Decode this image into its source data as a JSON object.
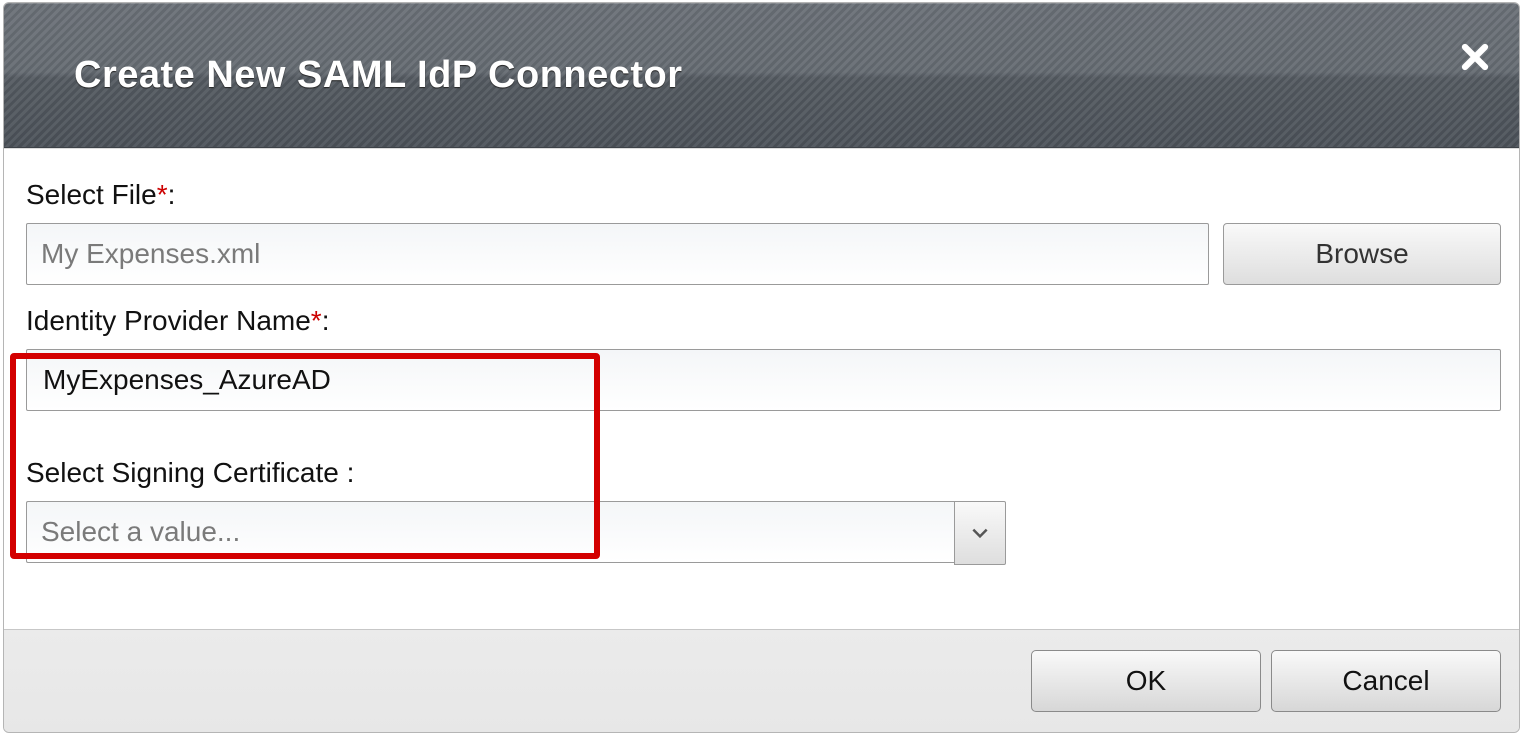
{
  "dialog": {
    "title": "Create New SAML IdP Connector"
  },
  "form": {
    "file": {
      "label": "Select File",
      "required_marker": "*",
      "colon": ":",
      "value": "My Expenses.xml",
      "browse_label": "Browse"
    },
    "idp_name": {
      "label": "Identity Provider Name",
      "required_marker": "*",
      "colon": ":",
      "value": "MyExpenses_AzureAD"
    },
    "signing_cert": {
      "label": "Select Signing Certificate ",
      "colon": ":",
      "placeholder": "Select a value..."
    }
  },
  "buttons": {
    "ok": "OK",
    "cancel": "Cancel"
  }
}
